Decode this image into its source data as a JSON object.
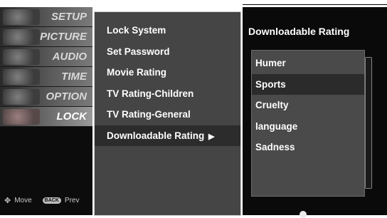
{
  "sidebar": {
    "items": [
      {
        "label": "SETUP",
        "active": false
      },
      {
        "label": "PICTURE",
        "active": false
      },
      {
        "label": "AUDIO",
        "active": false
      },
      {
        "label": "TIME",
        "active": false
      },
      {
        "label": "OPTION",
        "active": false
      },
      {
        "label": "LOCK",
        "active": true
      }
    ],
    "footer": {
      "move_label": "Move",
      "back_key_label": "BACK",
      "prev_label": "Prev"
    }
  },
  "lock_menu": {
    "items": [
      {
        "label": "Lock System"
      },
      {
        "label": "Set Password"
      },
      {
        "label": "Movie Rating"
      },
      {
        "label": "TV Rating-Children"
      },
      {
        "label": "TV Rating-General"
      },
      {
        "label": "Downloadable Rating",
        "submenu_arrow": "▶",
        "selected": true
      }
    ]
  },
  "submenu": {
    "title": "Downloadable Rating",
    "items": [
      {
        "label": "Humer"
      },
      {
        "label": "Sports",
        "selected": true
      },
      {
        "label": "Cruelty"
      },
      {
        "label": "language"
      },
      {
        "label": "Sadness"
      }
    ]
  }
}
